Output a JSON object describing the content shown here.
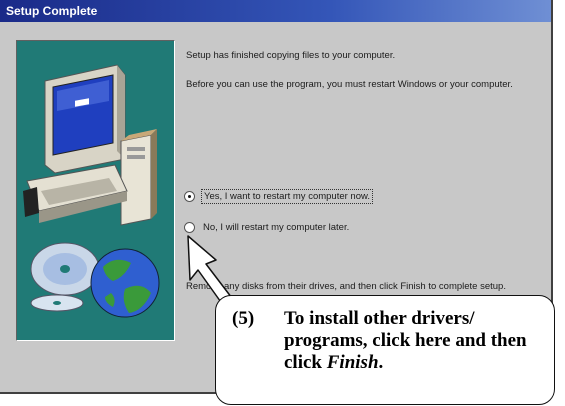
{
  "window": {
    "title": "Setup Complete"
  },
  "content": {
    "line1": "Setup has finished copying files to your computer.",
    "line2": "Before you can use the program, you must restart Windows or your computer.",
    "line3": "Remove any disks from their drives, and then click Finish to complete setup."
  },
  "options": {
    "restart_now": "Yes, I want to restart my computer now.",
    "restart_later": "No, I will restart my computer later.",
    "selected": "restart_now"
  },
  "callout": {
    "number": "(5)",
    "text_main": "To install other drivers/ programs, click here and then click ",
    "text_emph": "Finish",
    "text_end": "."
  },
  "colors": {
    "panel_teal": "#207a76",
    "dialog_gray": "#c8c8c8",
    "title_blue": "#1a2a88"
  },
  "icons": [
    "computer-illustration",
    "cd-disc-icon",
    "arrow-pointer-icon"
  ]
}
